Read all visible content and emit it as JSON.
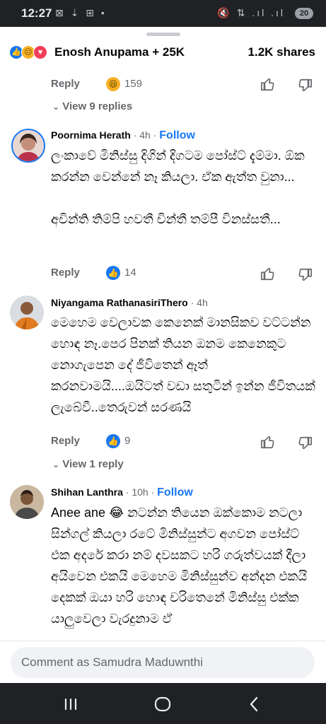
{
  "status_bar": {
    "time": "12:27",
    "left_icons": "⊠ ⇣ ⊞ •",
    "right_icons": "🔇 ⇅ .ıl .ıl",
    "battery": "20"
  },
  "header": {
    "reactor_summary": "Enosh Anupama + 25K",
    "shares": "1.2K shares"
  },
  "top_comment": {
    "reply_label": "Reply",
    "reaction_count": "159",
    "view_replies": "View 9 replies"
  },
  "comments": [
    {
      "author": "Poornima Herath",
      "time": "· 4h ·",
      "follow": "Follow",
      "text": "ලංකාවේ මිනිස්සු දිගින් දිගටම පෝස්ට් දැම්මා. ඕක කරන්න වෙන්නේ නෑ කියලා. ඒක ඇත්ත වුනා...\n\nඅචින්ති තිම්පි හවතී චින්තී තම්පී විනස්සතී...",
      "reply_label": "Reply",
      "reaction_count": "14"
    },
    {
      "author": "Niyangama RathanasiriThero",
      "time": "· 4h",
      "text": "මෙහෙම වෙලාවක කෙනෙක් මානසිකව වට්ටන්න හොඳ නෑ.පෙර පිනක් තියන ඔනම කෙනෙකුට නොගැපෙන දේ ජීවිතෙන් ඈත් කරනවාමයි....ඔයිටත් වඩා සතුටින් ඉන්න ජීවිතයක් ලැබේවී..තෙරුවන් සරණයි",
      "reply_label": "Reply",
      "reaction_count": "9",
      "view_replies": "View 1 reply"
    },
    {
      "author": "Shihan Lanthra",
      "time": "· 10h ·",
      "follow": "Follow",
      "text": "Anee ane 😂 නටන්න තියෙන ඔක්කොම නටලා සින්ගල් කියලා රටේ මිනිස්සුන්ට අගවන පෝස්ට් එක අදරේ කරා නම් දවසකට හරි ගරුත්වයක් දීලා අයිවෙන එකයි මෙහෙම මිනිස්සුන්ව අන්දන එකයි දෙකක් ඔයා හරි හොඳ චරිතෙනේ මිනිස්සු එක්ක යාලුවෙලා වැරදුනාම ඒ"
    }
  ],
  "composer": {
    "placeholder": "Comment as Samudra Maduwnthi"
  },
  "icons": {
    "like": "thumbs-up-icon",
    "dislike": "thumbs-down-icon",
    "haha": "laughing-emoji-icon",
    "chevron": "chevron-down-icon"
  },
  "colors": {
    "accent": "#1877f2",
    "muted": "#65676b",
    "composer_bg": "#f0f2f5",
    "system_bar": "#202124"
  }
}
